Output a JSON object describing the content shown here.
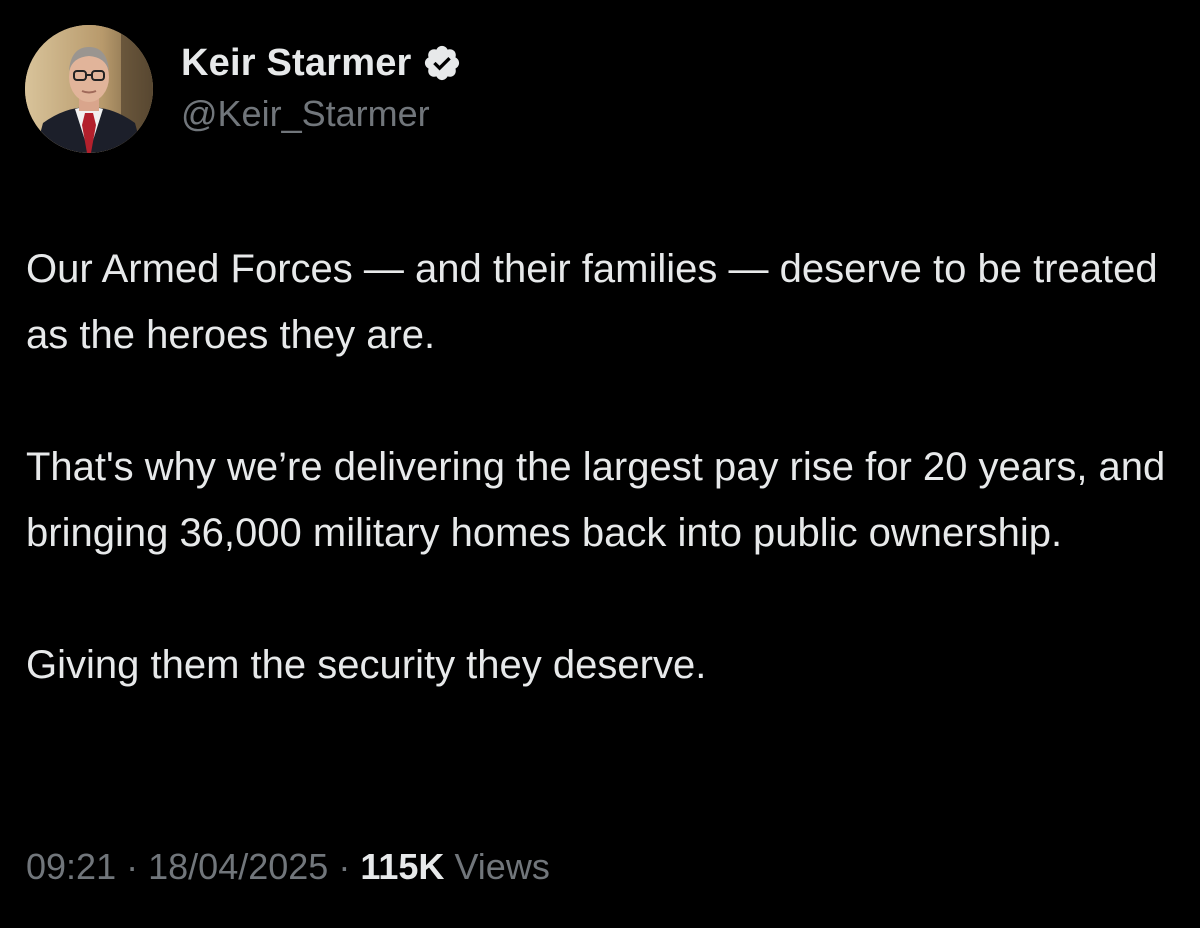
{
  "author": {
    "display_name": "Keir Starmer",
    "handle": "@Keir_Starmer",
    "verified_icon": "verified-badge-icon",
    "badge_color": "#e7e9ea"
  },
  "tweet": {
    "paragraphs": [
      "Our Armed Forces — and their families — deserve to be treated as the heroes they are.",
      "That's why we’re delivering the largest pay rise for 20 years, and bringing 36,000 military homes back into public ownership.",
      "Giving them the security they deserve."
    ],
    "time": "09:21",
    "date": "18/04/2025",
    "separator": "·",
    "views_count": "115K",
    "views_label": "Views"
  },
  "colors": {
    "background": "#000000",
    "text_primary": "#e7e9ea",
    "text_secondary": "#71767b"
  }
}
